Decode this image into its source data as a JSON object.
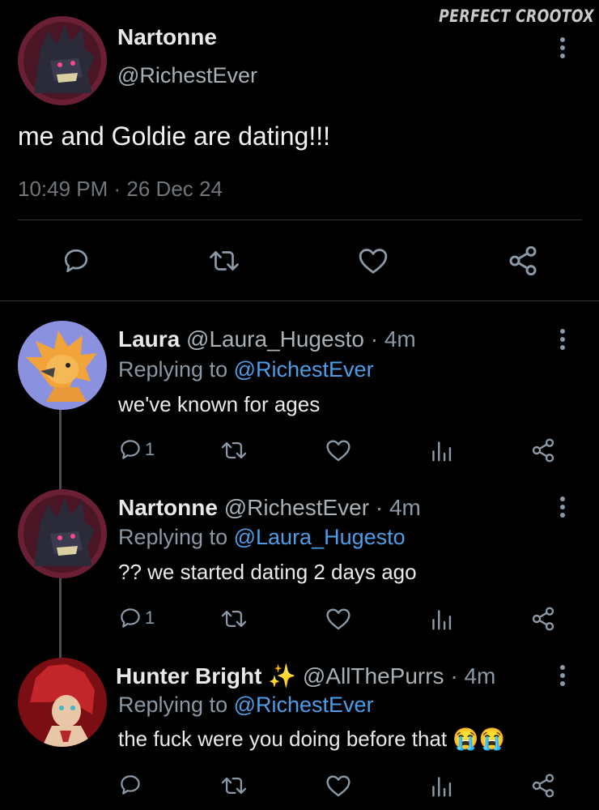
{
  "watermark": "PERFECT CROOTOX",
  "main_tweet": {
    "name": "Nartonne",
    "handle": "@RichestEver",
    "text": "me and Goldie are dating!!!",
    "timestamp": "10:49 PM · 26 Dec 24"
  },
  "replies": [
    {
      "name": "Laura",
      "handle": "@Laura_Hugesto",
      "dot": "·",
      "time": "4m",
      "replying_label": "Replying to",
      "replying_to": "@RichestEver",
      "text": "we've known for ages",
      "reply_count": "1"
    },
    {
      "name": "Nartonne",
      "handle": "@RichestEver",
      "dot": "·",
      "time": "4m",
      "replying_label": "Replying to",
      "replying_to": "@Laura_Hugesto",
      "text": "?? we started dating 2 days ago",
      "reply_count": "1"
    },
    {
      "name": "Hunter Bright",
      "name_emoji": "✨",
      "handle": "@AllThePurrs",
      "dot": "·",
      "time": "4m",
      "replying_label": "Replying to",
      "replying_to": "@RichestEver",
      "text": "the fuck were you doing before that",
      "text_emoji": "😭😭",
      "reply_count": ""
    }
  ],
  "colors": {
    "background": "#000000",
    "mention": "#4d9ee8",
    "secondary_text": "#8b98a5"
  }
}
